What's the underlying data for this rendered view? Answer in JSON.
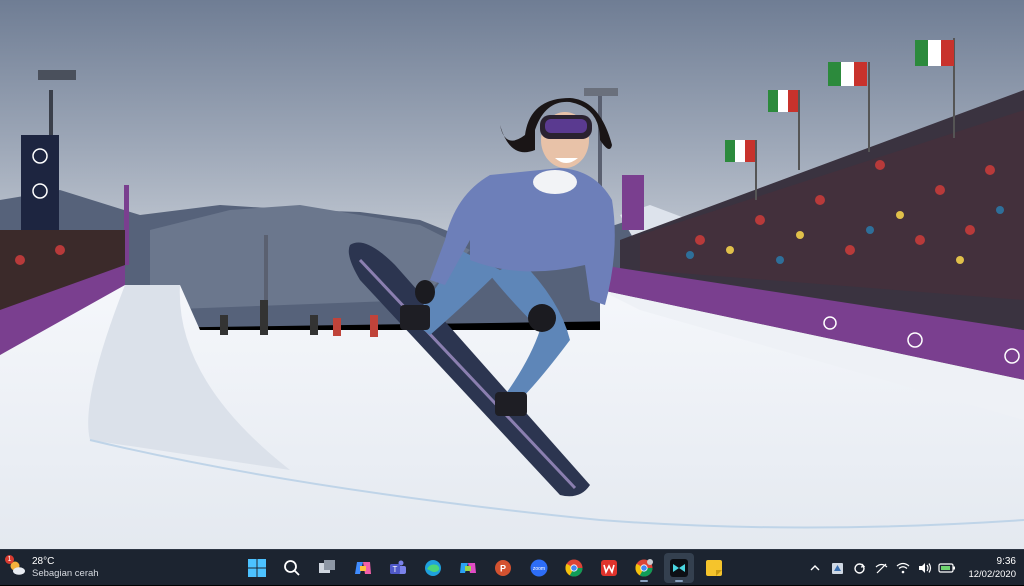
{
  "weather": {
    "temperature": "28°C",
    "condition": "Sebagian cerah",
    "badge": "1"
  },
  "taskbar": {
    "apps": [
      {
        "name": "start-button",
        "icon": "windows-logo-icon"
      },
      {
        "name": "search-button",
        "icon": "search-icon"
      },
      {
        "name": "task-view-button",
        "icon": "task-view-icon"
      },
      {
        "name": "copilot-button",
        "icon": "copilot-icon"
      },
      {
        "name": "teams-button",
        "icon": "teams-icon"
      },
      {
        "name": "edge-button",
        "icon": "edge-icon"
      },
      {
        "name": "copilot-alt-button",
        "icon": "copilot-alt-icon"
      },
      {
        "name": "powerpoint-button",
        "icon": "powerpoint-icon"
      },
      {
        "name": "zoom-button",
        "icon": "zoom-icon",
        "label": "zoom"
      },
      {
        "name": "chrome-button",
        "icon": "chrome-icon"
      },
      {
        "name": "wps-button",
        "icon": "wps-icon"
      },
      {
        "name": "chrome-profile-button",
        "icon": "chrome-icon"
      },
      {
        "name": "capcut-button",
        "icon": "capcut-icon"
      },
      {
        "name": "sticky-notes-button",
        "icon": "sticky-notes-icon"
      }
    ]
  },
  "tray": {
    "time": "9:36",
    "date": "12/02/2020",
    "icons": [
      "chevron-up-icon",
      "defender-icon",
      "sync-icon",
      "no-wifi-icon",
      "wifi-icon",
      "volume-icon",
      "battery-icon"
    ]
  },
  "wallpaper": {
    "colors": {
      "sky_top": "#8e9bb0",
      "sky_bottom": "#c5ccd6",
      "mountain": "#5f6b80",
      "snow": "#f4f6fa",
      "banner": "#7a3f8f",
      "jacket": "#6f7fb8"
    }
  }
}
